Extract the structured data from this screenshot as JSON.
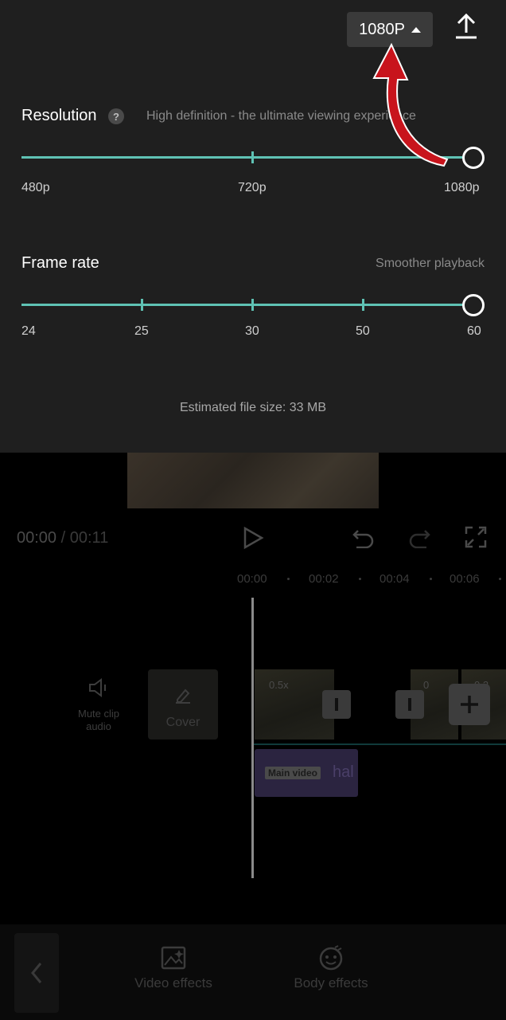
{
  "export": {
    "resolution_badge": "1080P",
    "resolution": {
      "title": "Resolution",
      "help": "?",
      "description": "High definition - the ultimate viewing experience",
      "labels": [
        "480p",
        "720p",
        "1080p"
      ],
      "selected": "1080p"
    },
    "frame_rate": {
      "title": "Frame rate",
      "description": "Smoother playback",
      "labels": [
        "24",
        "25",
        "30",
        "50",
        "60"
      ],
      "selected": "60"
    },
    "file_size": "Estimated file size: 33 MB"
  },
  "player": {
    "current_time": "00:00",
    "separator": "/",
    "total_time": "00:11"
  },
  "timeline": {
    "ruler": [
      "00:00",
      "00:02",
      "00:04",
      "00:06"
    ],
    "mute_label": "Mute clip audio",
    "cover_label": "Cover",
    "speed_labels": [
      "0.5x",
      "0",
      "0.2"
    ],
    "main_tag": "Main video",
    "main_name": "hal"
  },
  "toolbar": {
    "items": [
      {
        "label": "Video effects",
        "icon": "video-effects-icon"
      },
      {
        "label": "Body effects",
        "icon": "body-effects-icon"
      }
    ]
  },
  "colors": {
    "accent": "#5fc2b4",
    "panel": "#1f1f1f",
    "arrow": "#c8141c"
  }
}
